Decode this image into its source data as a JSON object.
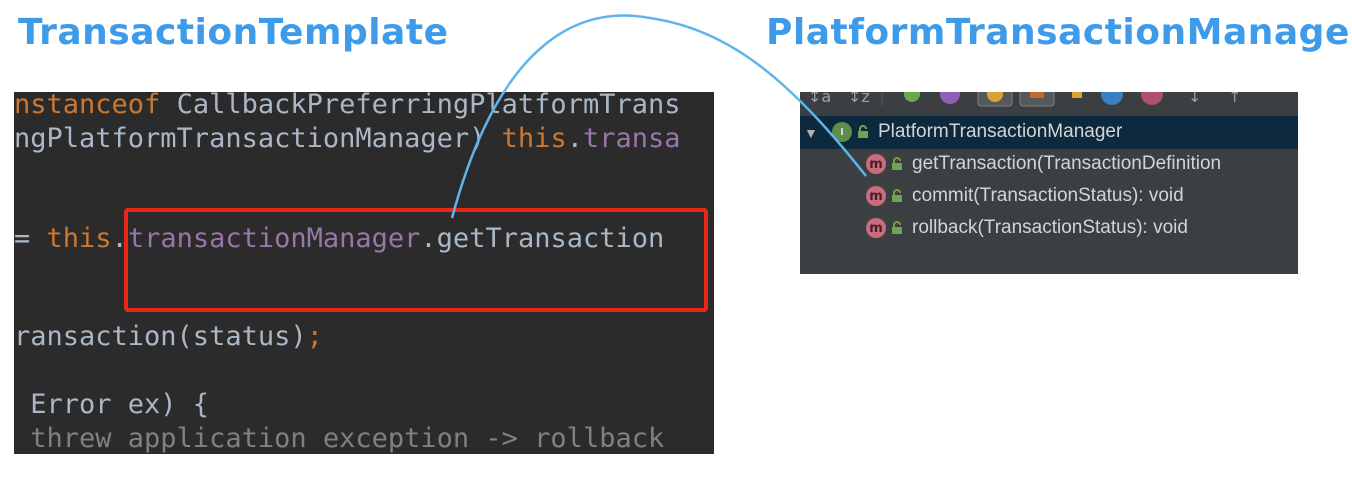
{
  "headings": {
    "left": "TransactionTemplate",
    "right": "PlatformTransactionManager",
    "color": "#3d9be9"
  },
  "code_lines": [
    [
      {
        "t": "nstanceof ",
        "c": "#cc7832"
      },
      {
        "t": "CallbackPreferringPlatformTrans",
        "c": "#a9b7c6"
      }
    ],
    [
      {
        "t": "ngPlatformTransactionManager) ",
        "c": "#a9b7c6"
      },
      {
        "t": "this",
        "c": "#cc7832"
      },
      {
        "t": ".",
        "c": "#a9b7c6"
      },
      {
        "t": "transa",
        "c": "#9876aa"
      }
    ],
    [],
    [
      {
        "t": "= ",
        "c": "#a9b7c6"
      },
      {
        "t": "this",
        "c": "#cc7832"
      },
      {
        "t": ".",
        "c": "#a9b7c6"
      },
      {
        "t": "transactionManager",
        "c": "#9876aa"
      },
      {
        "t": ".getTransaction",
        "c": "#a9b7c6"
      }
    ],
    [],
    [
      {
        "t": "ransaction(status)",
        "c": "#a9b7c6"
      },
      {
        "t": ";",
        "c": "#cc7832"
      }
    ],
    [],
    [
      {
        "t": " Error ex) {",
        "c": "#a9b7c6"
      }
    ],
    [
      {
        "t": " threw application exception -> rollback",
        "c": "#808080"
      }
    ]
  ],
  "structure": {
    "interface_name": "PlatformTransactionManager",
    "interface_badge": "I",
    "method_badge": "m",
    "methods": [
      "getTransaction(TransactionDefinition",
      "commit(TransactionStatus): void",
      "rollback(TransactionStatus): void"
    ]
  },
  "colors": {
    "highlight_box": "#e8271a",
    "connector": "#5fb4ec"
  }
}
